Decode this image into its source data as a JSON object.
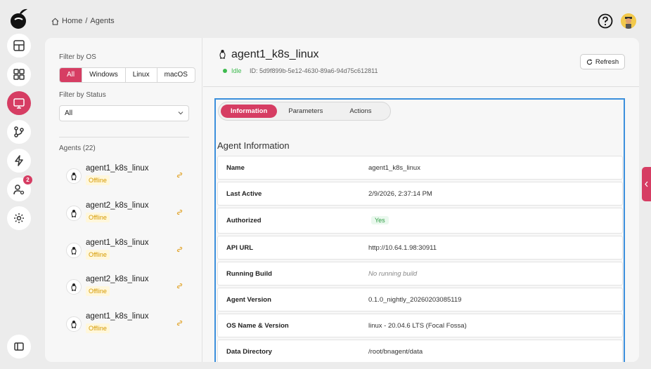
{
  "breadcrumb": {
    "home": "Home",
    "sep": "/",
    "current": "Agents"
  },
  "rail": {
    "items": [
      "tools-icon",
      "dashboard-icon",
      "monitor-icon",
      "git-branch-icon",
      "lightning-icon",
      "user-settings-icon",
      "gear-icon"
    ],
    "active": "monitor-icon",
    "badge": "2"
  },
  "filters": {
    "os_label": "Filter by OS",
    "os_options": [
      "All",
      "Windows",
      "Linux",
      "macOS"
    ],
    "os_selected": "All",
    "status_label": "Filter by Status",
    "status_value": "All",
    "agents_label": "Agents (22)"
  },
  "agents": [
    {
      "name": "agent1_k8s_linux",
      "status": "Offline"
    },
    {
      "name": "agent2_k8s_linux",
      "status": "Offline"
    },
    {
      "name": "agent1_k8s_linux",
      "status": "Offline"
    },
    {
      "name": "agent2_k8s_linux",
      "status": "Offline"
    },
    {
      "name": "agent1_k8s_linux",
      "status": "Offline"
    }
  ],
  "detail": {
    "title": "agent1_k8s_linux",
    "status": "Idle",
    "id": "ID: 5d9f899b-5e12-4630-89a6-94d75c612811",
    "refresh": "Refresh",
    "tabs": [
      "Information",
      "Parameters",
      "Actions"
    ],
    "active_tab": "Information",
    "section_title": "Agent Information",
    "rows": [
      {
        "key": "Name",
        "value": "agent1_k8s_linux"
      },
      {
        "key": "Last Active",
        "value": "2/9/2026, 2:37:14 PM"
      },
      {
        "key": "Authorized",
        "value": "Yes"
      },
      {
        "key": "API URL",
        "value": "http://10.64.1.98:30911"
      },
      {
        "key": "Running Build",
        "value": "No running build"
      },
      {
        "key": "Agent Version",
        "value": "0.1.0_nightly_20260203085119"
      },
      {
        "key": "OS Name & Version",
        "value": "linux - 20.04.6 LTS (Focal Fossa)"
      },
      {
        "key": "Data Directory",
        "value": "/root/bnagent/data"
      }
    ]
  },
  "colors": {
    "accent": "#d63d63",
    "idle": "#3dba4e",
    "offline": "#d69a00",
    "focus": "#3b8fdc"
  }
}
